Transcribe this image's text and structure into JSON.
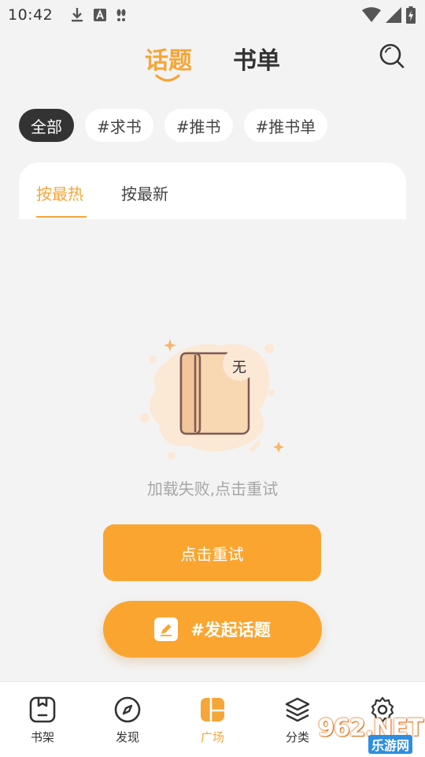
{
  "status_bar": {
    "time": "10:42"
  },
  "header": {
    "tab_topic": "话题",
    "tab_booklist": "书单",
    "search_icon": "search-icon"
  },
  "chips": [
    {
      "label": "全部",
      "active": true
    },
    {
      "label": "#求书",
      "active": false
    },
    {
      "label": "#推书",
      "active": false
    },
    {
      "label": "#推书单",
      "active": false
    }
  ],
  "sort_tabs": [
    {
      "label": "按最热",
      "active": true
    },
    {
      "label": "按最新",
      "active": false
    }
  ],
  "empty_state": {
    "badge": "无",
    "message": "加载失败,点击重试",
    "retry_label": "点击重试"
  },
  "start_topic_label": "#发起话题",
  "bottom_nav": [
    {
      "label": "书架",
      "icon": "bookshelf-icon",
      "active": false
    },
    {
      "label": "发现",
      "icon": "compass-icon",
      "active": false
    },
    {
      "label": "广场",
      "icon": "square-icon",
      "active": true
    },
    {
      "label": "分类",
      "icon": "layers-icon",
      "active": false
    },
    {
      "label": "",
      "icon": "gear-icon",
      "active": false
    }
  ],
  "watermark": {
    "main": "962.NET",
    "sub": "乐游网"
  },
  "colors": {
    "accent": "#f5a638",
    "button": "#fba531",
    "background": "#f3f3f3",
    "chip_active": "#333333"
  }
}
